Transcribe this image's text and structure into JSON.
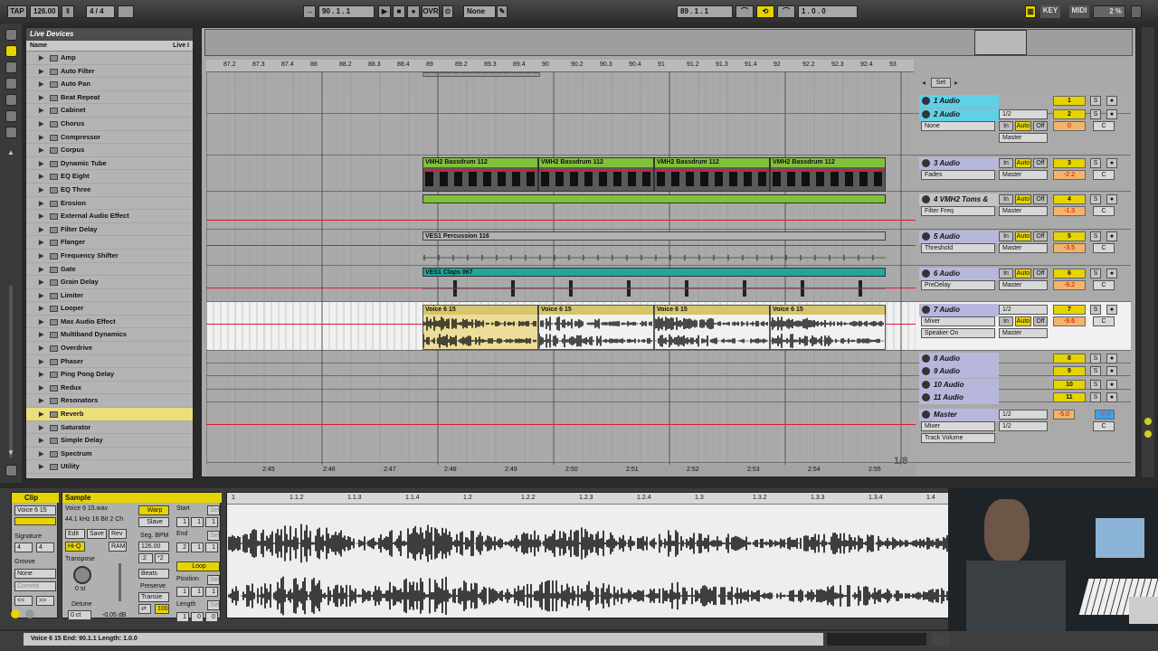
{
  "transport": {
    "tap": "TAP",
    "tempo": "126.00",
    "signature": "4 / 4",
    "metronome": "",
    "position": "90 .  1 .  1",
    "ovr": "OVR",
    "quantize": "None",
    "loop_start": "89 .  1 .  1",
    "loop_length": "1 .  0 .  0",
    "key": "KEY",
    "midi": "MIDI",
    "cpu": "2 %",
    "d_indicator": "D"
  },
  "browser": {
    "title": "Live Devices",
    "col_name": "Name",
    "col_live": "Live I",
    "items": [
      "Amp",
      "Auto Filter",
      "Auto Pan",
      "Beat Repeat",
      "Cabinet",
      "Chorus",
      "Compressor",
      "Corpus",
      "Dynamic Tube",
      "EQ Eight",
      "EQ Three",
      "Erosion",
      "External Audio Effect",
      "Filter Delay",
      "Flanger",
      "Frequency Shifter",
      "Gate",
      "Grain Delay",
      "Limiter",
      "Looper",
      "Max Audio Effect",
      "Multiband Dynamics",
      "Overdrive",
      "Phaser",
      "Ping Pong Delay",
      "Redux",
      "Resonators",
      "Reverb",
      "Saturator",
      "Simple Delay",
      "Spectrum",
      "Utility"
    ],
    "selected_index": 27
  },
  "ruler": {
    "bars": [
      "87.2",
      "87.3",
      "87.4",
      "88",
      "88.2",
      "88.3",
      "88.4",
      "89",
      "89.2",
      "89.3",
      "89.4",
      "90",
      "90.2",
      "90.3",
      "90.4",
      "91",
      "91.2",
      "91.3",
      "91.4",
      "92",
      "92.2",
      "92.3",
      "92.4",
      "93"
    ],
    "time": [
      "2:45",
      "2:46",
      "2:47",
      "2:48",
      "2:49",
      "2:50",
      "2:51",
      "2:52",
      "2:53",
      "2:54",
      "2:55"
    ],
    "page": "1/8",
    "set_label": "Set"
  },
  "clips": {
    "bassdrum": [
      "VMH2 Bassdrum 112",
      "VMH2 Bassdrum 112",
      "VMH2 Bassdrum 112",
      "VMH2 Bassdrum 112"
    ],
    "percussion": "VES1 Percussion 116",
    "claps": "VES1 Claps 067",
    "voice": [
      "Voice 6 15",
      "Voice 6 15",
      "Voice 6 15",
      "Voice 6 15"
    ]
  },
  "mixer": {
    "tracks": [
      {
        "name": "1 Audio",
        "num": "1",
        "vol": "",
        "color": "#5fd0e8"
      },
      {
        "name": "2 Audio",
        "num": "2",
        "vol": "0",
        "color": "#5fd0e8",
        "in": "1/2",
        "out": "Master",
        "device": "None"
      },
      {
        "name": "3 Audio",
        "num": "3",
        "vol": "-2.2",
        "color": "#b7b7dd",
        "device": "Fades",
        "out": "Master"
      },
      {
        "name": "4 VMH2 Toms &",
        "num": "4",
        "vol": "-1.3",
        "color": "#c4c4c4",
        "device": "Filter Freq",
        "out": "Master"
      },
      {
        "name": "5 Audio",
        "num": "5",
        "vol": "-3.5",
        "color": "#b7b7dd",
        "device": "Threshold",
        "out": "Master"
      },
      {
        "name": "6 Audio",
        "num": "6",
        "vol": "-9.2",
        "color": "#b7b7dd",
        "device": "PreDelay",
        "out": "Master"
      },
      {
        "name": "7 Audio",
        "num": "7",
        "vol": "-9.6",
        "color": "#b7b7dd",
        "device": "Mixer",
        "device2": "Speaker On",
        "in": "1/2",
        "out": "Master"
      },
      {
        "name": "8 Audio",
        "num": "8"
      },
      {
        "name": "9 Audio",
        "num": "9"
      },
      {
        "name": "10 Audio",
        "num": "10"
      },
      {
        "name": "11 Audio",
        "num": "11"
      }
    ],
    "master": {
      "name": "Master",
      "vol": "-5.0",
      "vol2": "-5.9",
      "in": "1/2",
      "out": "1/2",
      "device": "Mixer",
      "param": "Track Volume"
    },
    "in_label": "In",
    "auto_label": "Auto",
    "off_label": "Off",
    "solo": "S",
    "center": "C"
  },
  "detail": {
    "clip_title": "Clip",
    "clip_name": "Voice 6 15",
    "signature_label": "Signature",
    "sig_num": "4",
    "sig_den": "4",
    "groove_label": "Groove",
    "groove_value": "None",
    "commit": "Commit",
    "sample_title": "Sample",
    "sample_file": "Voice 6 15.wav",
    "sample_info": "44.1 kHz 16 Bit 2 Ch",
    "edit": "Edit",
    "save": "Save",
    "rev": "Rev",
    "hiq": "Hi-Q",
    "ram": "RAM",
    "transpose_label": "Transpose",
    "transpose_value": "0 st",
    "detune_label": "Detune",
    "detune_value": "0 ct",
    "gain_value": "-0.05 dB",
    "warp": "Warp",
    "slave": "Slave",
    "seg_bpm_label": "Seg. BPM",
    "seg_bpm": "126.00",
    "half": ":2",
    "double": "*2",
    "warp_mode": "Beats",
    "preserve_label": "Preserve",
    "preserve_value": "Transie",
    "loop_amount": "100",
    "start_label": "Start",
    "end_label": "End",
    "loop": "Loop",
    "position_label": "Position",
    "length_label": "Length",
    "set": "Set",
    "start_vals": [
      "1",
      "1",
      "1"
    ],
    "end_vals": [
      "2",
      "1",
      "1"
    ],
    "pos_vals": [
      "1",
      "1",
      "1"
    ],
    "len_vals": [
      "1",
      "0",
      "0"
    ],
    "ruler": [
      "1",
      "1.1.2",
      "1.1.3",
      "1.1.4",
      "1.2",
      "1.2.2",
      "1.2.3",
      "1.2.4",
      "1.3",
      "1.3.2",
      "1.3.3",
      "1.3.4",
      "1.4"
    ]
  },
  "status": {
    "text": "Voice 6 15  End: 90.1.1  Length: 1.0.0"
  },
  "colors": {
    "accent_yellow": "#e6d400",
    "bassdrum_clip": "#7fc23a",
    "claps_clip": "#1fa89a",
    "voice_clip": "#d6c56a",
    "automation_red": "#e0163a",
    "track_cyan": "#5fd0e8"
  }
}
